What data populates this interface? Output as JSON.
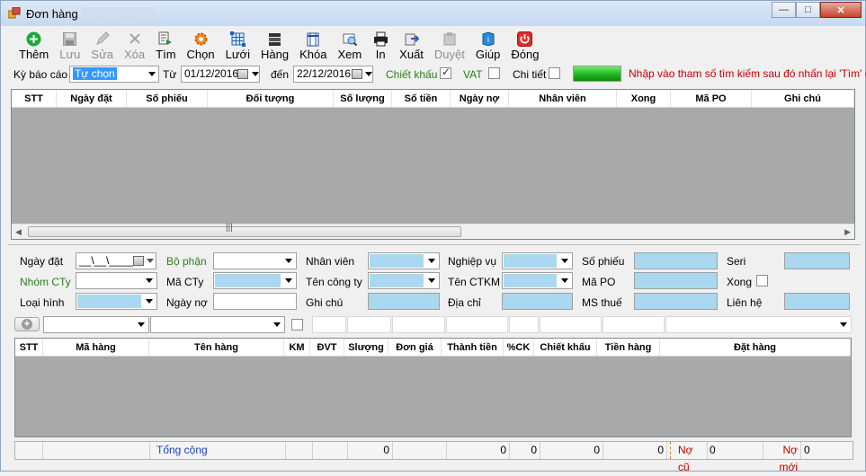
{
  "window": {
    "title": "Đơn hàng",
    "buttons": [
      "—",
      "□",
      "✕"
    ]
  },
  "toolbar": [
    {
      "name": "add",
      "label": "Thêm",
      "icon": "plus-circle-icon",
      "enabled": true
    },
    {
      "name": "save",
      "label": "Lưu",
      "icon": "floppy-icon",
      "enabled": false
    },
    {
      "name": "edit",
      "label": "Sửa",
      "icon": "pencil-icon",
      "enabled": false
    },
    {
      "name": "delete",
      "label": "Xóa",
      "icon": "x-icon",
      "enabled": false
    },
    {
      "name": "find",
      "label": "Tìm",
      "icon": "find-icon",
      "enabled": true
    },
    {
      "name": "choose",
      "label": "Chọn",
      "icon": "gear-icon",
      "enabled": true
    },
    {
      "name": "grid",
      "label": "Lưới",
      "icon": "grid-icon",
      "enabled": true
    },
    {
      "name": "items",
      "label": "Hàng",
      "icon": "books-icon",
      "enabled": true
    },
    {
      "name": "lock",
      "label": "Khóa",
      "icon": "lock-icon",
      "enabled": true
    },
    {
      "name": "view",
      "label": "Xem",
      "icon": "preview-icon",
      "enabled": true
    },
    {
      "name": "print",
      "label": "In",
      "icon": "printer-icon",
      "enabled": true
    },
    {
      "name": "export",
      "label": "Xuất",
      "icon": "export-icon",
      "enabled": true
    },
    {
      "name": "approve",
      "label": "Duyệt",
      "icon": "approve-icon",
      "enabled": false
    },
    {
      "name": "help",
      "label": "Giúp",
      "icon": "help-book-icon",
      "enabled": true
    },
    {
      "name": "close",
      "label": "Đóng",
      "icon": "power-icon",
      "enabled": true
    }
  ],
  "filter": {
    "period_label": "Kỳ báo cáo",
    "period_value": "Tự chọn",
    "from_label": "Từ",
    "from_value": "01/12/2016",
    "to_label": "đến",
    "to_value": "22/12/2016",
    "discount_label": "Chiết khấu",
    "discount_checked": true,
    "vat_label": "VAT",
    "vat_checked": false,
    "detail_label": "Chi tiết",
    "detail_checked": false,
    "hint": "Nhập vào tham số tìm kiếm sau đó nhấn lại 'Tìm' để"
  },
  "orders_grid": {
    "columns": [
      "STT",
      "Ngày đặt",
      "Số phiếu",
      "Đối tượng",
      "Số lượng",
      "Số tiền",
      "Ngày nợ",
      "Nhân viên",
      "Xong",
      "Mã PO",
      "Ghi chú"
    ],
    "rows": []
  },
  "form": {
    "order_date_label": "Ngày đặt",
    "order_date_value": "__\\__\\____",
    "dept_label": "Bộ phận",
    "employee_label": "Nhân viên",
    "business_label": "Nghiệp vụ",
    "voucher_label": "Số phiếu",
    "serial_label": "Seri",
    "company_group_label": "Nhóm CTy",
    "company_code_label": "Mã CTy",
    "company_name_label": "Tên công ty",
    "promo_label": "Tên CTKM",
    "po_label": "Mã PO",
    "done_label": "Xong",
    "type_label": "Loại hình",
    "debt_date_label": "Ngày nợ",
    "note_label": "Ghi chú",
    "address_label": "Địa chỉ",
    "tax_label": "MS thuế",
    "contact_label": "Liên hệ"
  },
  "items_grid": {
    "columns": [
      "STT",
      "Mã hàng",
      "Tên hàng",
      "KM",
      "ĐVT",
      "Slượng",
      "Đơn giá",
      "Thành tiền",
      "%CK",
      "Chiết khấu",
      "Tiền hàng",
      "Đặt hàng"
    ],
    "rows": []
  },
  "footer": {
    "total_label": "Tổng cộng",
    "qty_total": "0",
    "amount_total": "0",
    "pct_total": "0",
    "discount_total": "0",
    "goods_total": "0",
    "old_debt_label": "Nợ cũ",
    "old_debt_value": "0",
    "new_debt_label": "Nợ mới",
    "new_debt_value": "0"
  },
  "colors": {
    "accent_blue_field": "#a9d8f0",
    "hint_red": "#c00000",
    "green_label": "#2e7d1a",
    "progress_green": "#1eaf1e"
  }
}
